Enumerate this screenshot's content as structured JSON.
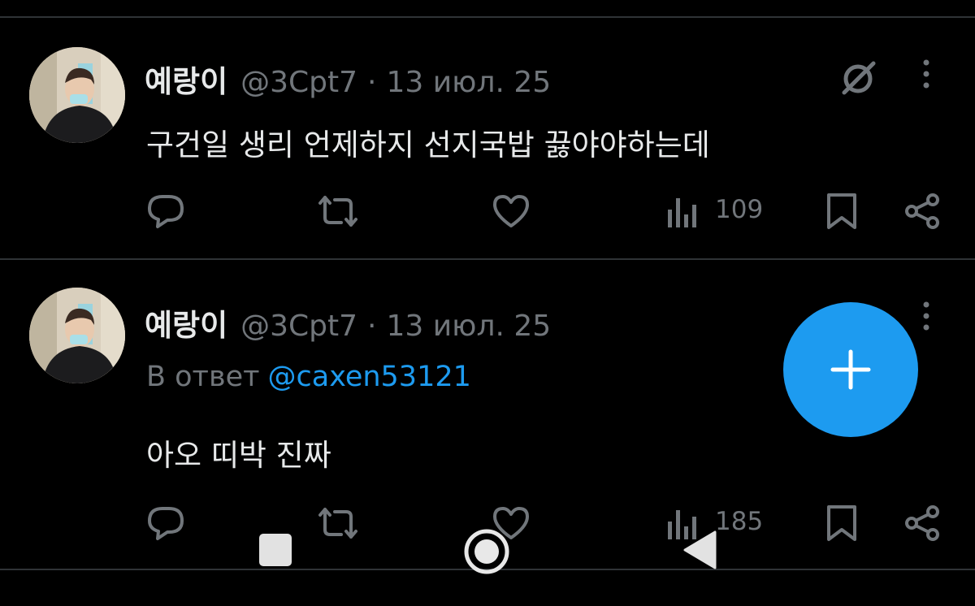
{
  "posts": [
    {
      "author": "예랑이",
      "handle": "@3Cpt7",
      "separator": "·",
      "date": "13 июл. 25",
      "text": "구건일 생리 언제하지 선지국밥 끓야야하는데",
      "views": "109",
      "avatar_icon": "avatar-photo"
    },
    {
      "author": "예랑이",
      "handle": "@3Cpt7",
      "separator": "·",
      "date": "13 июл. 25",
      "reply_prefix": "В ответ",
      "reply_to": "@caxen53121",
      "text": "아오 띠박 진짜",
      "views": "185",
      "avatar_icon": "avatar-photo"
    }
  ],
  "icons": {
    "reply": "speech-bubble-icon",
    "repost": "repost-arrows-icon",
    "like": "heart-icon",
    "views": "bar-chart-icon",
    "bookmark": "bookmark-icon",
    "share": "share-nodes-icon",
    "grok": "grok-slash-circle-icon",
    "more": "vertical-dots-icon",
    "compose": "plus-icon",
    "nav_recents": "square-icon",
    "nav_home": "circle-icon",
    "nav_back": "triangle-back-icon"
  },
  "colors": {
    "background": "#000000",
    "text_primary": "#e7e9ea",
    "text_secondary": "#71767b",
    "accent": "#1d9bf0",
    "divider": "#2f3336"
  }
}
